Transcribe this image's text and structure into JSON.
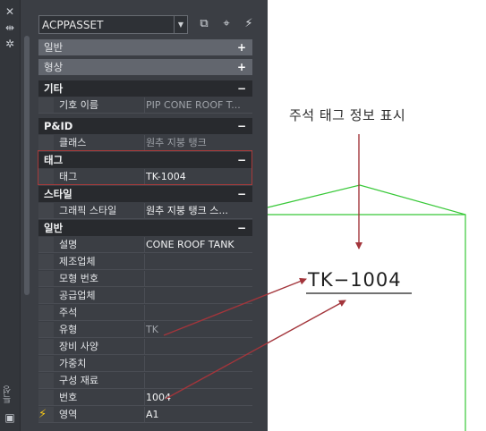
{
  "combo": {
    "value": "ACPPASSET"
  },
  "toolbar": {
    "icons": [
      "select-objects-icon",
      "pick-point-icon",
      "quick-select-icon"
    ]
  },
  "sections": [
    {
      "label": "일반",
      "toggle": "+"
    },
    {
      "label": "형상",
      "toggle": "+"
    },
    {
      "label": "기타",
      "toggle": "−"
    },
    {
      "label": "P&ID",
      "toggle": "−"
    },
    {
      "label": "태그",
      "toggle": "−"
    },
    {
      "label": "스타일",
      "toggle": "−"
    },
    {
      "label": "일반",
      "toggle": "−"
    }
  ],
  "rows": {
    "symbol_name": {
      "key": "기호 이름",
      "value": "PIP  CONE  ROOF  T..."
    },
    "class": {
      "key": "클래스",
      "value": "원추 지붕 탱크"
    },
    "tag": {
      "key": "태그",
      "value": "TK-1004"
    },
    "graphic_style": {
      "key": "그래픽 스타일",
      "value": "원추 지붕 탱크 스..."
    },
    "description": {
      "key": "설명",
      "value": "CONE ROOF TANK"
    },
    "manufacturer": {
      "key": "제조업체",
      "value": ""
    },
    "model_number": {
      "key": "모형 번호",
      "value": ""
    },
    "supplier": {
      "key": "공급업체",
      "value": ""
    },
    "comment": {
      "key": "주석",
      "value": ""
    },
    "type": {
      "key": "유형",
      "value": "TK"
    },
    "equipment_spec": {
      "key": "장비 사양",
      "value": ""
    },
    "weight": {
      "key": "가중치",
      "value": ""
    },
    "material": {
      "key": "구성 재료",
      "value": ""
    },
    "number": {
      "key": "번호",
      "value": "1004"
    },
    "area": {
      "key": "영역",
      "value": "A1"
    }
  },
  "side_strip": {
    "vertical_text": "특성"
  },
  "canvas": {
    "annotation": "주석 태그 정보 표시",
    "tag_label": "TK−1004"
  },
  "colors": {
    "panel": "#3b3e44",
    "highlight": "#a83a3a",
    "tank_line": "#37c837",
    "arrow": "#a3353b"
  }
}
